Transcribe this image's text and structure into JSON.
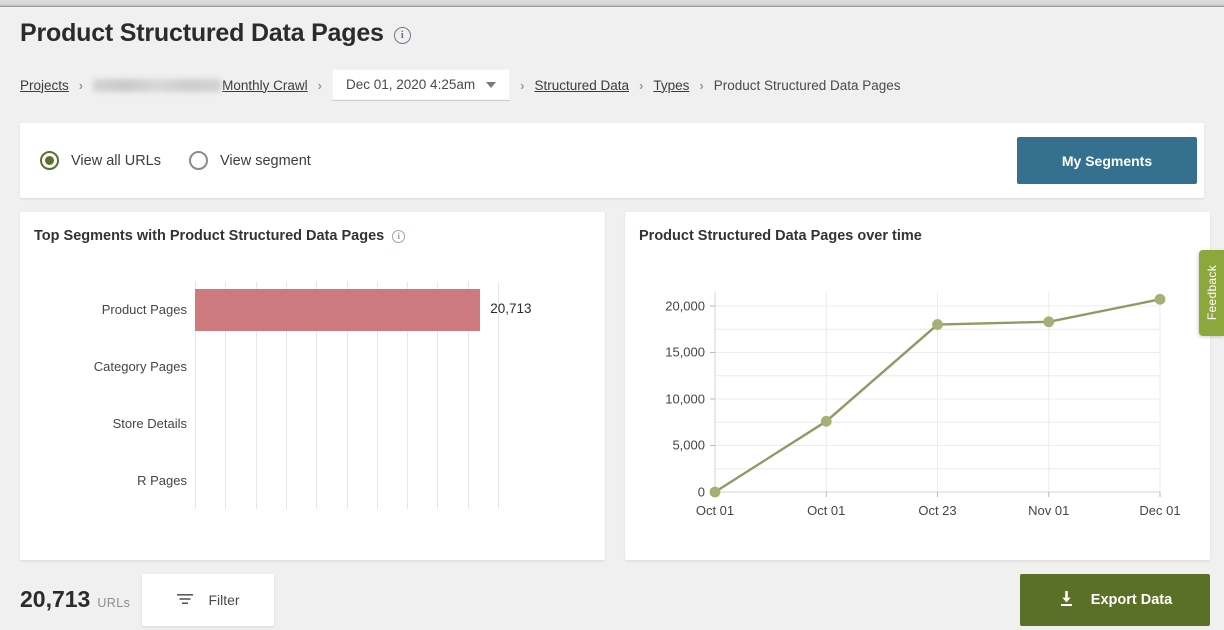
{
  "header": {
    "title": "Product Structured Data Pages",
    "info_icon": "info-icon",
    "breadcrumb": {
      "projects_label": "Projects",
      "crawl_label": "Monthly Crawl",
      "date_value": "Dec 01, 2020 4:25am",
      "structured_data_label": "Structured Data",
      "types_label": "Types",
      "current_label": "Product Structured Data Pages",
      "separator": "›"
    }
  },
  "segment_bar": {
    "view_all_label": "View all URLs",
    "view_segment_label": "View segment",
    "selected": "View all URLs",
    "my_segments_label": "My Segments",
    "my_segments_color": "#35708F",
    "radio_color": "#5A7030"
  },
  "left_card": {
    "title": "Top Segments with Product Structured Data Pages",
    "info_icon": "info-icon"
  },
  "right_card": {
    "title": "Product Structured Data Pages over time"
  },
  "feedback": {
    "label": "Feedback",
    "color": "#8CA83D"
  },
  "footer": {
    "count": "20,713",
    "count_unit": "URLs",
    "filter_label": "Filter",
    "filter_icon": "filter-icon",
    "export_label": "Export Data",
    "export_icon": "download-icon",
    "export_color": "#5B7027"
  },
  "chart_data": [
    {
      "type": "bar",
      "orientation": "horizontal",
      "title": "Top Segments with Product Structured Data Pages",
      "categories": [
        "Product Pages",
        "Category Pages",
        "Store Details",
        "R Pages"
      ],
      "values": [
        20713,
        0,
        0,
        0
      ],
      "value_labels": [
        "20,713",
        "",
        "",
        ""
      ],
      "xlabel": "",
      "ylabel": "",
      "xlim": [
        0,
        22000
      ],
      "grid": "vertical",
      "gridline_count": 11,
      "bar_color": "#CC7A7E",
      "legend": "none"
    },
    {
      "type": "line",
      "title": "Product Structured Data Pages over time",
      "x": [
        "Oct 01",
        "Oct 01",
        "Oct 23",
        "Nov 01",
        "Dec 01"
      ],
      "values": [
        0,
        7600,
        18000,
        18300,
        20713
      ],
      "ylabel": "",
      "xlabel": "",
      "ylim": [
        0,
        21500
      ],
      "yticks": [
        0,
        5000,
        10000,
        15000,
        20000
      ],
      "ytick_labels": [
        "0",
        "5,000",
        "10,000",
        "15,000",
        "20,000"
      ],
      "grid": "horizontal-minor",
      "line_color": "#8C9C62",
      "marker": "circle",
      "legend": "none"
    }
  ]
}
